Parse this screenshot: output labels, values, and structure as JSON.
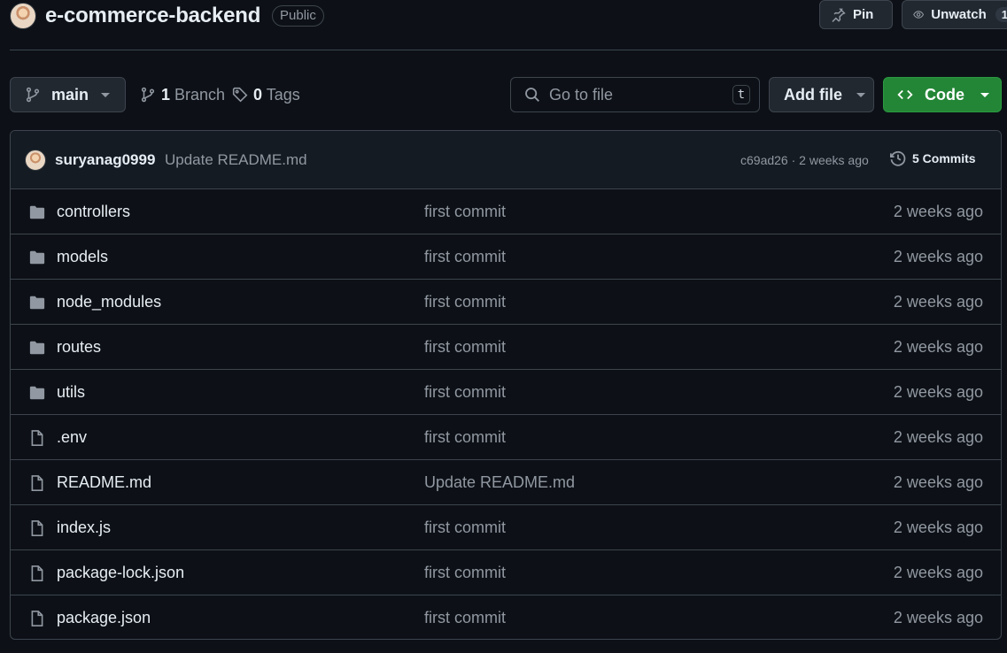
{
  "repo": {
    "name": "e-commerce-backend",
    "visibility": "Public"
  },
  "header_actions": {
    "pin_label": "Pin",
    "unwatch_label": "Unwatch",
    "watch_count": "1"
  },
  "toolbar": {
    "branch_name": "main",
    "branch_count": "1",
    "branch_label": "Branch",
    "tag_count": "0",
    "tag_label": "Tags",
    "search_placeholder": "Go to file",
    "search_shortcut": "t",
    "add_file_label": "Add file",
    "code_label": "Code"
  },
  "latest_commit": {
    "author": "suryanag0999",
    "message": "Update README.md",
    "meta": "c69ad26 · 2 weeks ago",
    "commits_label": "5 Commits"
  },
  "files": [
    {
      "type": "dir",
      "icon": "folder-icon",
      "name": "controllers",
      "message": "first commit",
      "age": "2 weeks ago"
    },
    {
      "type": "dir",
      "icon": "folder-icon",
      "name": "models",
      "message": "first commit",
      "age": "2 weeks ago"
    },
    {
      "type": "dir",
      "icon": "folder-icon",
      "name": "node_modules",
      "message": "first commit",
      "age": "2 weeks ago"
    },
    {
      "type": "dir",
      "icon": "folder-icon",
      "name": "routes",
      "message": "first commit",
      "age": "2 weeks ago"
    },
    {
      "type": "dir",
      "icon": "folder-icon",
      "name": "utils",
      "message": "first commit",
      "age": "2 weeks ago"
    },
    {
      "type": "file",
      "icon": "file-icon",
      "name": ".env",
      "message": "first commit",
      "age": "2 weeks ago"
    },
    {
      "type": "file",
      "icon": "file-icon",
      "name": "README.md",
      "message": "Update README.md",
      "age": "2 weeks ago"
    },
    {
      "type": "file",
      "icon": "file-icon",
      "name": "index.js",
      "message": "first commit",
      "age": "2 weeks ago"
    },
    {
      "type": "file",
      "icon": "file-icon",
      "name": "package-lock.json",
      "message": "first commit",
      "age": "2 weeks ago"
    },
    {
      "type": "file",
      "icon": "file-icon",
      "name": "package.json",
      "message": "first commit",
      "age": "2 weeks ago"
    }
  ],
  "colors": {
    "background": "#0d1117",
    "border": "#3d444d",
    "muted_text": "#9198a1",
    "primary_green": "#238636"
  }
}
